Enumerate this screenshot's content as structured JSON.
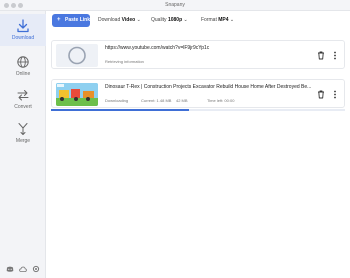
{
  "app": {
    "title": "Snapany"
  },
  "sidebar": {
    "items": [
      {
        "label": "Download",
        "icon": "download-icon",
        "active": true
      },
      {
        "label": "Online",
        "icon": "globe-icon"
      },
      {
        "label": "Convert",
        "icon": "convert-icon"
      },
      {
        "label": "Merge",
        "icon": "merge-icon"
      }
    ],
    "bottom_icons": [
      "discord-icon",
      "cloud-icon",
      "settings-icon"
    ]
  },
  "toolbar": {
    "paste_label": "Paste Link",
    "download_prefix": "Download",
    "download_value": "Video",
    "quality_prefix": "Quality",
    "quality_value": "1080p",
    "format_prefix": "Format",
    "format_value": "MP4"
  },
  "downloads": [
    {
      "title": "https://www.youtube.com/watch?v=lF9jr9cYp1c",
      "status": "Retrieving information",
      "thumbnail": "loading-spinner"
    },
    {
      "title": "Dinosaur T-Rex | Construction Projects Excavator Rebuild House Home After Destroyed Be...",
      "status": "Downloading",
      "speed": "Current: 1.48 MB",
      "size": "42 MB",
      "eta": "Time left: 00:00",
      "progress": 0.47
    }
  ],
  "colors": {
    "accent": "#4a78e0",
    "sidebar_bg": "#f3f4f7",
    "active_bg": "#e6ebf7"
  }
}
